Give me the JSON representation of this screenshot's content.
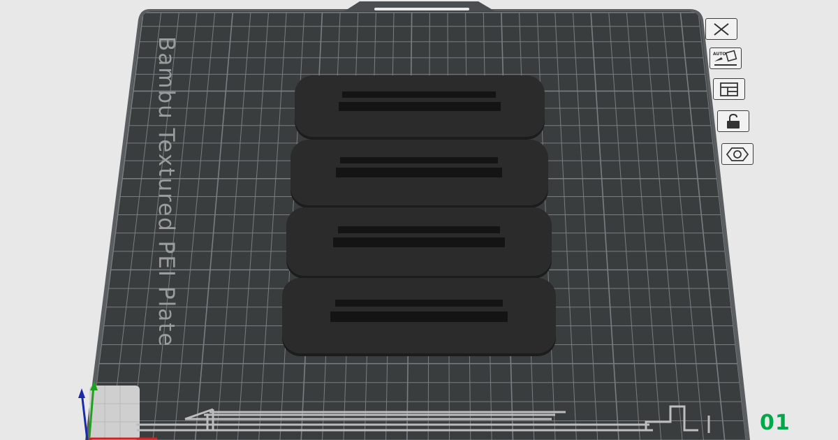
{
  "plate": {
    "label": "Bambu Textured PEI Plate",
    "number": "01"
  },
  "colors": {
    "background": "#e8e8e8",
    "plate": "#3a3d3e",
    "grid": "#7a7e80",
    "object": "#2b2b2b",
    "slot": "#141414",
    "plate_number": "#00a84a",
    "axis_x": "#d42020",
    "axis_y": "#20a020",
    "axis_z": "#1a2aa8"
  },
  "toolbar": {
    "buttons": [
      {
        "name": "close-plate-button",
        "icon": "close-icon"
      },
      {
        "name": "auto-orient-button",
        "icon": "auto-orient-icon",
        "text": "AUTO"
      },
      {
        "name": "arrange-button",
        "icon": "arrange-icon"
      },
      {
        "name": "lock-plate-button",
        "icon": "lock-icon"
      },
      {
        "name": "plate-settings-button",
        "icon": "hexagon-nut-icon"
      }
    ]
  },
  "objects": [
    {
      "name": "part-1"
    },
    {
      "name": "part-2"
    },
    {
      "name": "part-3"
    },
    {
      "name": "part-4"
    }
  ],
  "scene": {
    "view": "perspective",
    "grid": true
  }
}
